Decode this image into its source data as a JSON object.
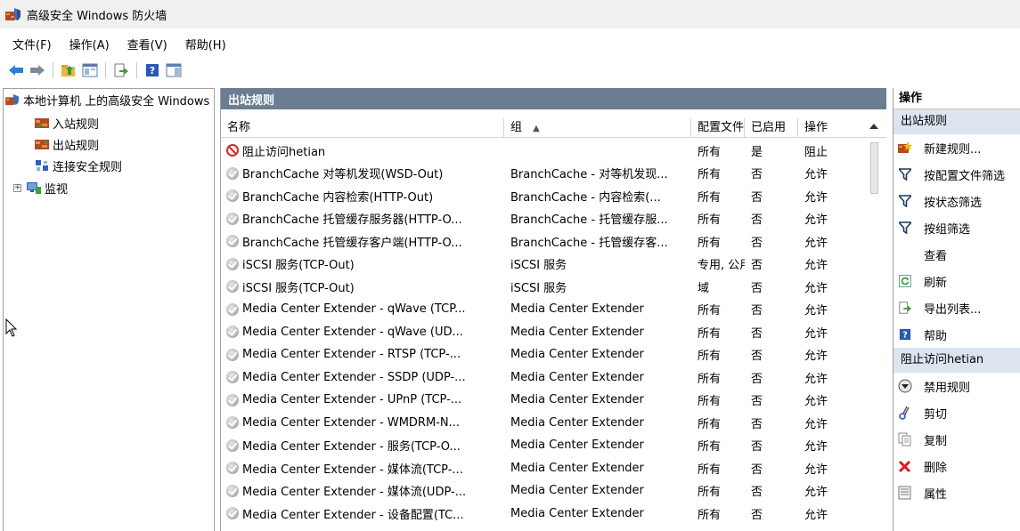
{
  "window": {
    "title": "高级安全 Windows 防火墙"
  },
  "menu": [
    "文件(F)",
    "操作(A)",
    "查看(V)",
    "帮助(H)"
  ],
  "toolbar": [
    "back-arrow-icon",
    "forward-arrow-icon",
    "up-folder-icon",
    "console-tree-icon",
    "export-icon",
    "help-icon",
    "action-pane-icon"
  ],
  "tree": {
    "root": "本地计算机 上的高级安全 Windows",
    "items": [
      "入站规则",
      "出站规则",
      "连接安全规则",
      "监视"
    ]
  },
  "center": {
    "title": "出站规则",
    "columns": [
      "名称",
      "组",
      "配置文件",
      "已启用",
      "操作"
    ],
    "sort_indicator": "▲",
    "rows": [
      {
        "icon": "block",
        "name": "阻止访问hetian",
        "group": "",
        "profile": "所有",
        "enabled": "是",
        "action": "阻止"
      },
      {
        "icon": "allow",
        "name": "BranchCache 对等机发现(WSD-Out)",
        "group": "BranchCache - 对等机发现...",
        "profile": "所有",
        "enabled": "否",
        "action": "允许"
      },
      {
        "icon": "allow",
        "name": "BranchCache 内容检索(HTTP-Out)",
        "group": "BranchCache - 内容检索(...",
        "profile": "所有",
        "enabled": "否",
        "action": "允许"
      },
      {
        "icon": "allow",
        "name": "BranchCache 托管缓存服务器(HTTP-O...",
        "group": "BranchCache - 托管缓存服...",
        "profile": "所有",
        "enabled": "否",
        "action": "允许"
      },
      {
        "icon": "allow",
        "name": "BranchCache 托管缓存客户端(HTTP-O...",
        "group": "BranchCache - 托管缓存客...",
        "profile": "所有",
        "enabled": "否",
        "action": "允许"
      },
      {
        "icon": "allow",
        "name": "iSCSI 服务(TCP-Out)",
        "group": "iSCSI 服务",
        "profile": "专用, 公用",
        "enabled": "否",
        "action": "允许"
      },
      {
        "icon": "allow",
        "name": "iSCSI 服务(TCP-Out)",
        "group": "iSCSI 服务",
        "profile": "域",
        "enabled": "否",
        "action": "允许"
      },
      {
        "icon": "allow",
        "name": "Media Center Extender - qWave (TCP...",
        "group": "Media Center Extender",
        "profile": "所有",
        "enabled": "否",
        "action": "允许"
      },
      {
        "icon": "allow",
        "name": "Media Center Extender - qWave (UD...",
        "group": "Media Center Extender",
        "profile": "所有",
        "enabled": "否",
        "action": "允许"
      },
      {
        "icon": "allow",
        "name": "Media Center Extender - RTSP (TCP-...",
        "group": "Media Center Extender",
        "profile": "所有",
        "enabled": "否",
        "action": "允许"
      },
      {
        "icon": "allow",
        "name": "Media Center Extender - SSDP (UDP-...",
        "group": "Media Center Extender",
        "profile": "所有",
        "enabled": "否",
        "action": "允许"
      },
      {
        "icon": "allow",
        "name": "Media Center Extender - UPnP (TCP-...",
        "group": "Media Center Extender",
        "profile": "所有",
        "enabled": "否",
        "action": "允许"
      },
      {
        "icon": "allow",
        "name": "Media Center Extender - WMDRM-N...",
        "group": "Media Center Extender",
        "profile": "所有",
        "enabled": "否",
        "action": "允许"
      },
      {
        "icon": "allow",
        "name": "Media Center Extender - 服务(TCP-O...",
        "group": "Media Center Extender",
        "profile": "所有",
        "enabled": "否",
        "action": "允许"
      },
      {
        "icon": "allow",
        "name": "Media Center Extender - 媒体流(TCP-...",
        "group": "Media Center Extender",
        "profile": "所有",
        "enabled": "否",
        "action": "允许"
      },
      {
        "icon": "allow",
        "name": "Media Center Extender - 媒体流(UDP-...",
        "group": "Media Center Extender",
        "profile": "所有",
        "enabled": "否",
        "action": "允许"
      },
      {
        "icon": "allow",
        "name": "Media Center Extender - 设备配置(TC...",
        "group": "Media Center Extender",
        "profile": "所有",
        "enabled": "否",
        "action": "允许"
      }
    ]
  },
  "actions": {
    "title": "操作",
    "section1": "出站规则",
    "items1": [
      {
        "icon": "new-rule-icon",
        "label": "新建规则..."
      },
      {
        "icon": "filter-icon",
        "label": "按配置文件筛选"
      },
      {
        "icon": "filter-icon",
        "label": "按状态筛选"
      },
      {
        "icon": "filter-icon",
        "label": "按组筛选"
      },
      {
        "icon": "",
        "label": "查看"
      },
      {
        "icon": "refresh-icon",
        "label": "刷新"
      },
      {
        "icon": "export-icon",
        "label": "导出列表..."
      },
      {
        "icon": "help-icon",
        "label": "帮助"
      }
    ],
    "section2": "阻止访问hetian",
    "items2": [
      {
        "icon": "disable-rule-icon",
        "label": "禁用规则"
      },
      {
        "icon": "cut-icon",
        "label": "剪切"
      },
      {
        "icon": "copy-icon",
        "label": "复制"
      },
      {
        "icon": "delete-icon",
        "label": "删除"
      },
      {
        "icon": "properties-icon",
        "label": "属性"
      }
    ]
  }
}
